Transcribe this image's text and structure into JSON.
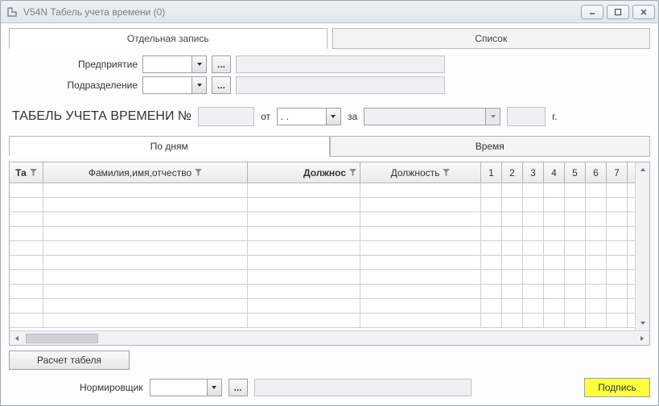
{
  "window": {
    "title": "V54N Табель учета времени (0)"
  },
  "top_tabs": {
    "single": "Отдельная запись",
    "list": "Список"
  },
  "form": {
    "enterprise_label": "Предприятие",
    "department_label": "Подразделение"
  },
  "header": {
    "title": "ТАБЕЛЬ УЧЕТА ВРЕМЕНИ №",
    "from_label": "от",
    "date_value": ". .",
    "for_label": "за",
    "year_suffix": "г."
  },
  "sub_tabs": {
    "by_days": "По дням",
    "time": "Время"
  },
  "grid": {
    "col_tab": "Та",
    "col_fio": "Фамилия,имя,отчество",
    "col_position_bold": "Должнос",
    "col_position": "Должность",
    "days": [
      "1",
      "2",
      "3",
      "4",
      "5",
      "6",
      "7"
    ]
  },
  "buttons": {
    "calc": "Расчет табеля",
    "ellipsis": "...",
    "norm_label": "Нормировщик",
    "sign": "Подпись"
  }
}
